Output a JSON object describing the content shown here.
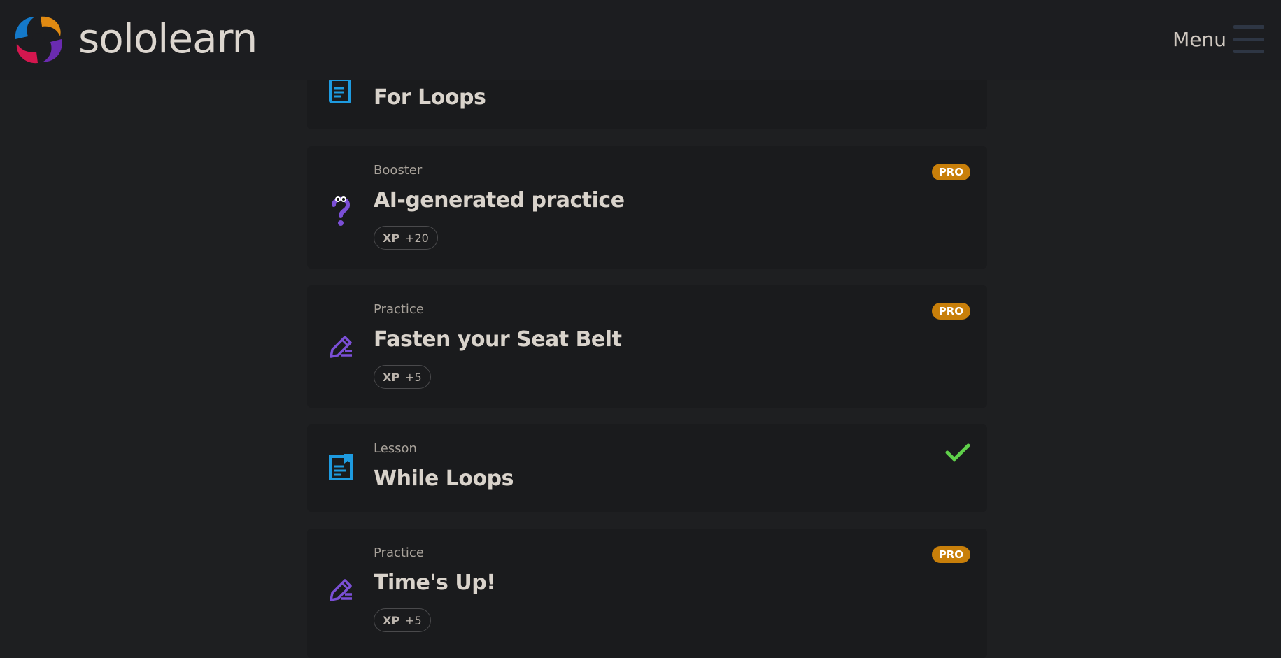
{
  "header": {
    "brand": "sololearn",
    "menu_label": "Menu"
  },
  "items": [
    {
      "type": "",
      "title": "For Loops",
      "icon": "lesson-icon",
      "pro": "",
      "xp": ""
    },
    {
      "type": "Booster",
      "title": "AI-generated practice",
      "icon": "question-mark-character-icon",
      "pro": "PRO",
      "xp_label": "XP",
      "xp_value": "+20"
    },
    {
      "type": "Practice",
      "title": "Fasten your Seat Belt",
      "icon": "pencil-edit-icon",
      "pro": "PRO",
      "xp_label": "XP",
      "xp_value": "+5"
    },
    {
      "type": "Lesson",
      "title": "While Loops",
      "icon": "lesson-icon",
      "status": "completed-check-icon"
    },
    {
      "type": "Practice",
      "title": "Time's Up!",
      "icon": "pencil-edit-icon",
      "pro": "PRO",
      "xp_label": "XP",
      "xp_value": "+5"
    }
  ],
  "colors": {
    "background": "#1e1f21",
    "card": "#1a1b1d",
    "pro_badge": "#c87f0a",
    "lesson_icon": "#1e9be0",
    "practice_icon": "#7b4fd6",
    "check": "#5fd04a"
  }
}
